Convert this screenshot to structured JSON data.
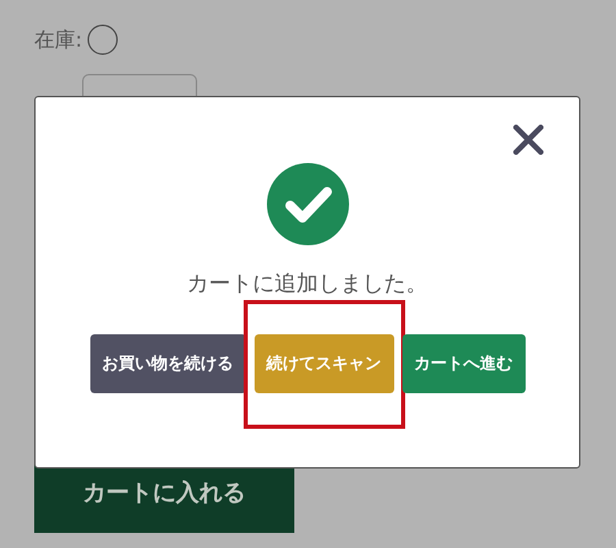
{
  "page": {
    "stock_label": "在庫:",
    "cart_button": "カートに入れる"
  },
  "modal": {
    "message": "カートに追加しました。",
    "buttons": [
      {
        "label": "お買い物を続ける",
        "kind": "secondary",
        "highlighted": false
      },
      {
        "label": "続けてスキャン",
        "kind": "warning",
        "highlighted": true
      },
      {
        "label": "カートへ進む",
        "kind": "primary",
        "highlighted": false
      }
    ]
  }
}
